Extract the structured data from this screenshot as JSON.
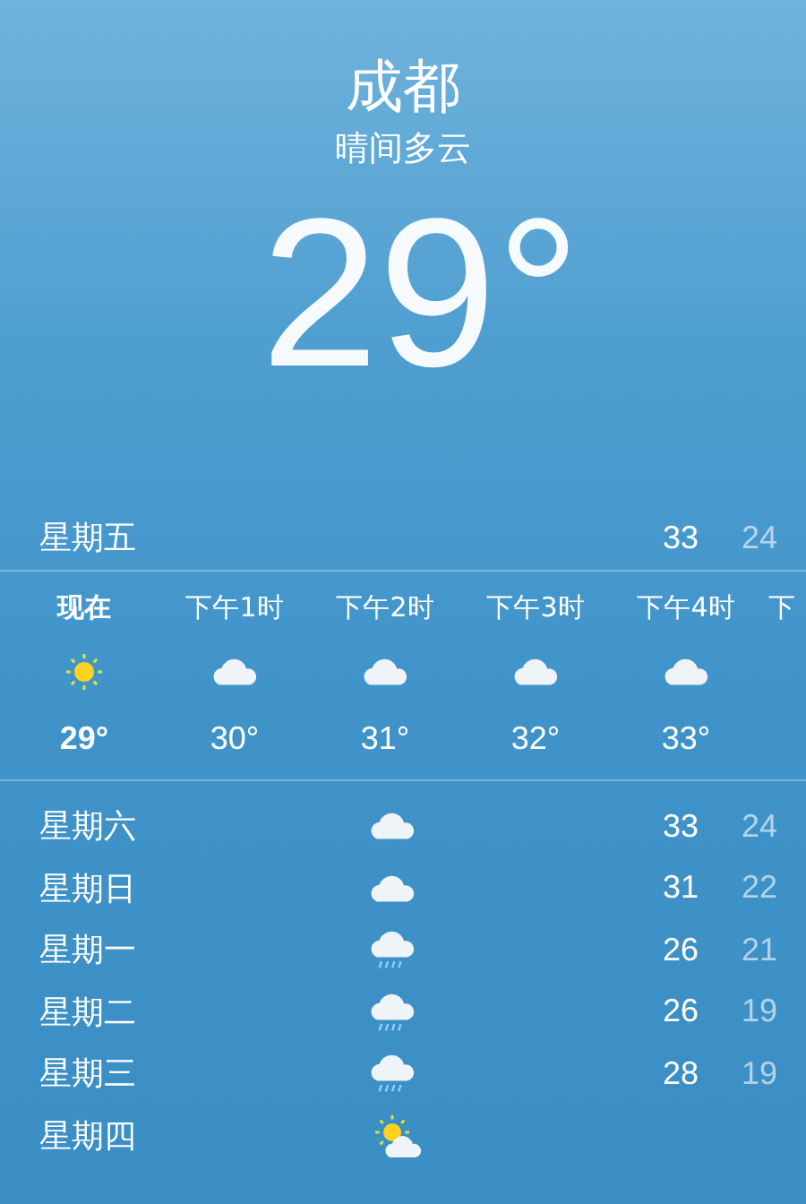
{
  "header": {
    "city": "成都",
    "condition": "晴间多云",
    "temperature": "29°"
  },
  "today": {
    "day": "星期五",
    "high": "33",
    "low": "24"
  },
  "hourly": [
    {
      "time": "现在",
      "kind": "sun",
      "temp": "29°",
      "selected": true
    },
    {
      "time": "下午1时",
      "kind": "cloud",
      "temp": "30°",
      "selected": false
    },
    {
      "time": "下午2时",
      "kind": "cloud",
      "temp": "31°",
      "selected": false
    },
    {
      "time": "下午3时",
      "kind": "cloud",
      "temp": "32°",
      "selected": false
    },
    {
      "time": "下午4时",
      "kind": "cloud",
      "temp": "33°",
      "selected": false
    },
    {
      "time": "下"
    }
  ],
  "daily": [
    {
      "day": "星期六",
      "kind": "cloud",
      "high": "33",
      "low": "24"
    },
    {
      "day": "星期日",
      "kind": "cloud",
      "high": "31",
      "low": "22"
    },
    {
      "day": "星期一",
      "kind": "rain",
      "high": "26",
      "low": "21"
    },
    {
      "day": "星期二",
      "kind": "rain",
      "high": "26",
      "low": "19"
    },
    {
      "day": "星期三",
      "kind": "rain",
      "high": "28",
      "low": "19"
    },
    {
      "day": "星期四",
      "kind": "partly"
    }
  ]
}
